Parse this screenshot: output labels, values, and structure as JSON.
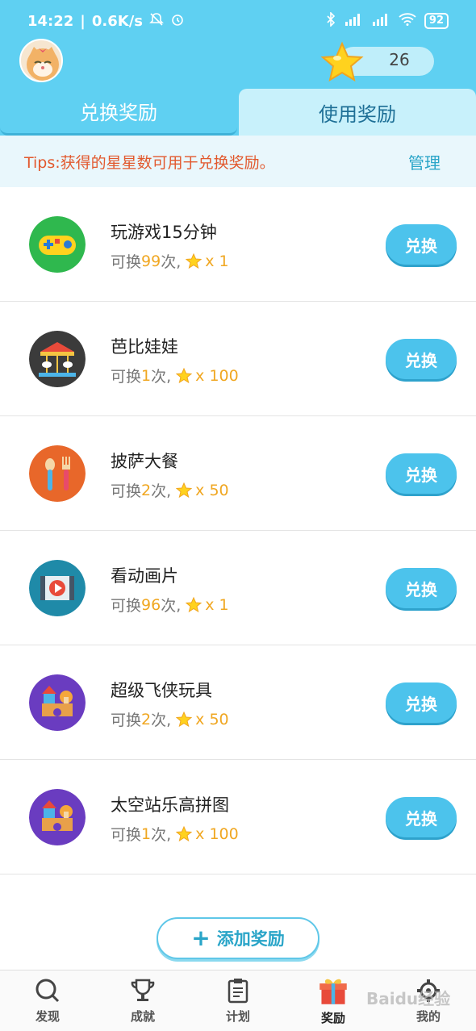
{
  "status_bar": {
    "time": "14:22",
    "speed": "0.6K/s",
    "battery": "92"
  },
  "header": {
    "star_count": "26",
    "tabs": [
      {
        "label": "兑换奖励",
        "active": true
      },
      {
        "label": "使用奖励",
        "active": false
      }
    ],
    "tips": "Tips:获得的星星数可用于兑换奖励。",
    "manage_label": "管理"
  },
  "rewards": [
    {
      "title": "玩游戏15分钟",
      "prefix": "可换",
      "count": "99",
      "suffix": "次,",
      "cost": "x 1",
      "icon": "gamepad-icon",
      "button": "兑换"
    },
    {
      "title": "芭比娃娃",
      "prefix": "可换",
      "count": "1",
      "suffix": "次,",
      "cost": "x 100",
      "icon": "carousel-icon",
      "button": "兑换"
    },
    {
      "title": "披萨大餐",
      "prefix": "可换",
      "count": "2",
      "suffix": "次,",
      "cost": "x 50",
      "icon": "spoon-fork-icon",
      "button": "兑换"
    },
    {
      "title": "看动画片",
      "prefix": "可换",
      "count": "96",
      "suffix": "次,",
      "cost": "x 1",
      "icon": "video-play-icon",
      "button": "兑换"
    },
    {
      "title": "超级飞侠玩具",
      "prefix": "可换",
      "count": "2",
      "suffix": "次,",
      "cost": "x 50",
      "icon": "toy-blocks-icon",
      "button": "兑换"
    },
    {
      "title": "太空站乐高拼图",
      "prefix": "可换",
      "count": "1",
      "suffix": "次,",
      "cost": "x 100",
      "icon": "toy-blocks-icon",
      "button": "兑换"
    }
  ],
  "add_button": "添加奖励",
  "nav": [
    {
      "label": "发现",
      "icon": "search-icon",
      "active": false
    },
    {
      "label": "成就",
      "icon": "trophy-icon",
      "active": false
    },
    {
      "label": "计划",
      "icon": "clipboard-icon",
      "active": false
    },
    {
      "label": "奖励",
      "icon": "gift-icon",
      "active": true
    },
    {
      "label": "我的",
      "icon": "gear-icon",
      "active": false
    }
  ],
  "watermark": "Baidu经验",
  "colors": {
    "header": "#5fd0f2",
    "accent": "#4cc3ec",
    "tips": "#e2592e",
    "highlight": "#f0a722"
  }
}
